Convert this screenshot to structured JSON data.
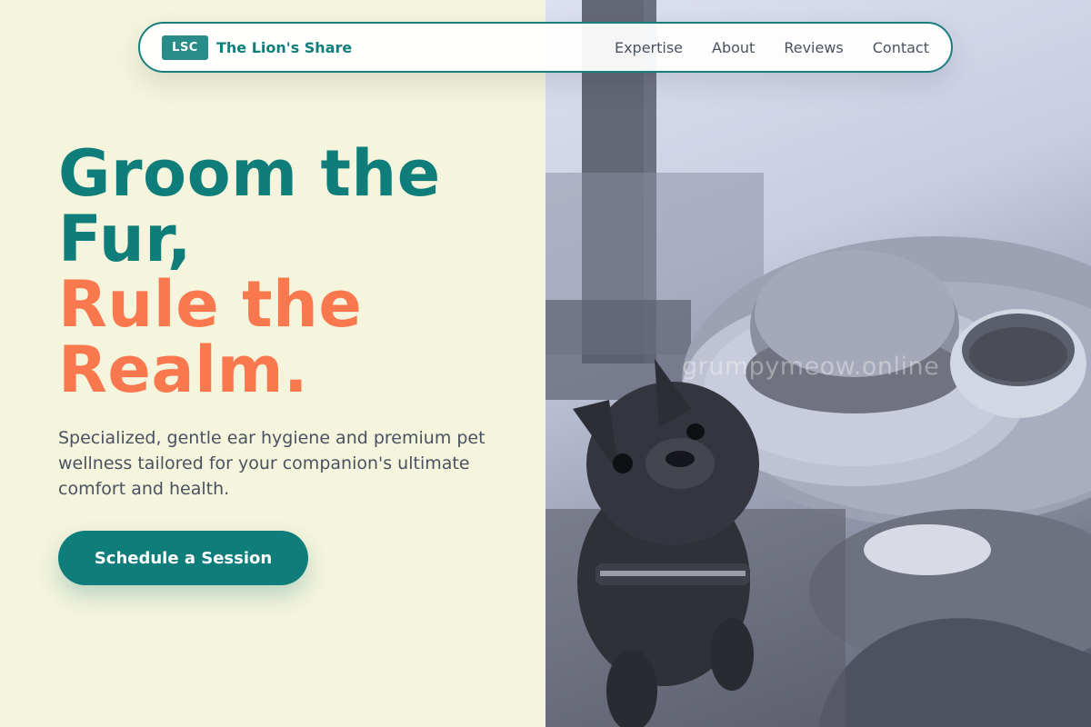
{
  "nav": {
    "logo_badge": "LSC",
    "brand_name": "The Lion's Share",
    "links": [
      {
        "label": "Expertise"
      },
      {
        "label": "About"
      },
      {
        "label": "Reviews"
      },
      {
        "label": "Contact"
      }
    ]
  },
  "hero": {
    "title_line1": "Groom the",
    "title_line2": "Fur,",
    "accent_line1": "Rule the",
    "accent_line2": "Realm.",
    "description": "Specialized, gentle ear hygiene and premium pet wellness tailored for your companion's ultimate comfort and health.",
    "cta_label": "Schedule a Session"
  },
  "image": {
    "subject": "French bulldog looking up at a café table with a plate and cup",
    "watermark": "grumpymeow.online"
  },
  "colors": {
    "primary_teal": "#0f7d7a",
    "accent_coral": "#f9784e",
    "background_cream": "#f5f4dc",
    "body_text": "#4a5261"
  }
}
